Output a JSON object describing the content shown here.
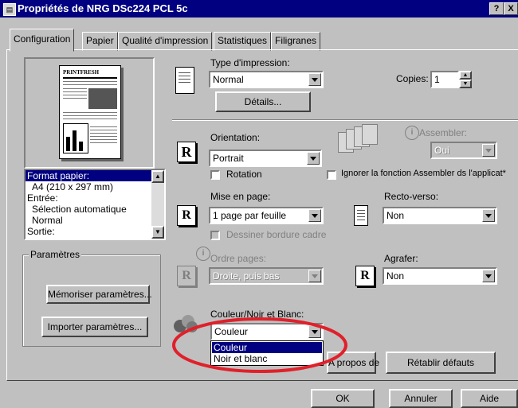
{
  "window": {
    "title": "Propriétés de NRG DSc224 PCL 5c",
    "help_btn": "?",
    "close_btn": "X",
    "icon": "printer-icon"
  },
  "tabs": [
    "Configuration",
    "Papier",
    "Qualité d'impression",
    "Statistiques",
    "Filigranes"
  ],
  "preview": {
    "masthead": "PRINTFRESH",
    "info_lines": [
      "Format papier:",
      "A4 (210 x 297 mm)",
      "Entrée:",
      "Sélection automatique",
      "Normal",
      "Sortie:"
    ]
  },
  "settings_group": {
    "label": "Paramètres",
    "save_btn": "Mémoriser paramètres...",
    "import_btn": "Importer paramètres..."
  },
  "print_type": {
    "label": "Type d'impression:",
    "value": "Normal",
    "details_btn": "Détails..."
  },
  "copies": {
    "label": "Copies:",
    "value": "1"
  },
  "orientation": {
    "label": "Orientation:",
    "value": "Portrait",
    "rotation_label": "Rotation"
  },
  "collate": {
    "label": "Assembler:",
    "value": "Oui",
    "ignore_label": "Ignorer la fonction Assembler ds l'applicat*"
  },
  "layout": {
    "label": "Mise en page:",
    "value": "1 page par feuille",
    "border_label": "Dessiner bordure cadre"
  },
  "duplex": {
    "label": "Recto-verso:",
    "value": "Non"
  },
  "page_order": {
    "label": "Ordre pages:",
    "value": "Droite, puis bas"
  },
  "staple": {
    "label": "Agrafer:",
    "value": "Non"
  },
  "color": {
    "label": "Couleur/Noir et Blanc:",
    "value": "Couleur",
    "options": [
      "Couleur",
      "Noir et blanc"
    ]
  },
  "about_btn": "A propos de",
  "reset_btn": "Rétablir défauts",
  "footer": {
    "ok": "OK",
    "cancel": "Annuler",
    "help": "Aide"
  },
  "icons": {
    "r_letter": "R"
  },
  "highlight_color": "#e0202a"
}
